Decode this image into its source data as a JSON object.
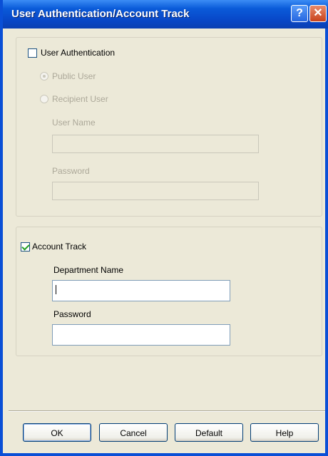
{
  "window": {
    "title": "User Authentication/Account Track",
    "help_symbol": "?",
    "close_symbol": "✕"
  },
  "user_auth": {
    "checkbox_label": "User Authentication",
    "checked": false,
    "public_user_label": "Public User",
    "recipient_user_label": "Recipient User",
    "user_name_label": "User Name",
    "user_name_value": "",
    "password_label": "Password",
    "password_value": ""
  },
  "account_track": {
    "checkbox_label": "Account Track",
    "checked": true,
    "department_label": "Department Name",
    "department_value": "",
    "password_label": "Password",
    "password_value": ""
  },
  "buttons": {
    "ok": "OK",
    "cancel": "Cancel",
    "default": "Default",
    "help": "Help"
  }
}
